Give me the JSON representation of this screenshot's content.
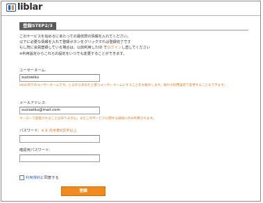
{
  "app": {
    "logo_text": "liblar"
  },
  "colors": {
    "accent": "#e07a1f",
    "button": "#f08a1c",
    "badge": "#5a5a5a",
    "link": "#3a66b8"
  },
  "step": {
    "label": "登録STEP2/3"
  },
  "intro": {
    "line1": "このサービスを始めるにあたっての最低限の情報を入れてください。",
    "line2": "以下に必要な情報を入れて登録ボタンをクリックすれば登録完了です",
    "line3_before": "もし既に会員登録している場合は、以前利用したID で",
    "line3_link": "ログイン",
    "line3_after": "し直してください",
    "line4": "※利用設定からこれらの設定をいつでも変更することができます。"
  },
  "form": {
    "username": {
      "label": "ユーザーネーム:",
      "value": "suziseiku",
      "note": "liblar内でのユーザーネームです。とるからあなたと使うユーザーネームにすることをお勧めします。後から利用設定で変更することもできます。"
    },
    "email": {
      "label": "メールアドレス:",
      "value": "suziseiku@mail.com",
      "note": "ホーローで変換されることはありません。またこのサービスに関する通知にのみ利用されます。"
    },
    "password": {
      "label": "パスワード:",
      "hint": "※ 6 内半角6文字以上",
      "value": ""
    },
    "password_confirm": {
      "label": "確認用パスワード:",
      "value": ""
    },
    "terms": {
      "link": "利用規約",
      "suffix": "に同意する",
      "checked": false
    },
    "submit_label": "登録"
  }
}
